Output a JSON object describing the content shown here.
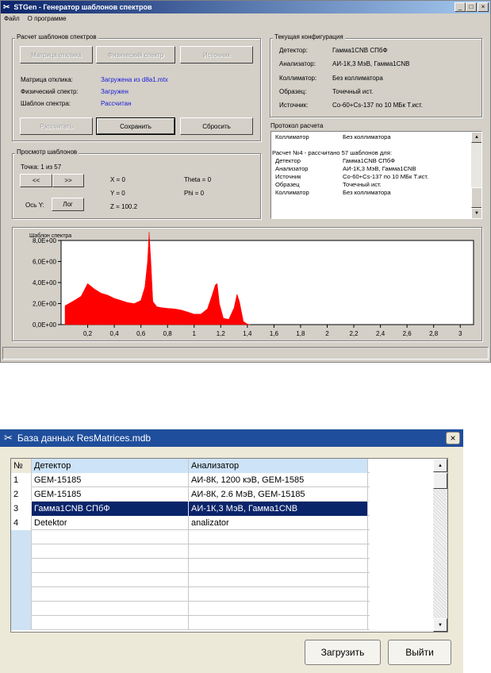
{
  "win1": {
    "title": "STGen - Генератор шаблонов спектров",
    "min": "_",
    "max": "□",
    "close": "×",
    "menu": [
      "Файл",
      "О программе"
    ]
  },
  "calc": {
    "title": "Расчет шаблонов спектров",
    "btn_matrix": "Матрица отклика",
    "btn_phys": "Физический спектр",
    "btn_source": "Источник",
    "rows": [
      {
        "k": "Матрица отклика:",
        "v": "Загружена из d8a1.mtx"
      },
      {
        "k": "Физический спектр:",
        "v": "Загружен"
      },
      {
        "k": "Шаблон спектра:",
        "v": "Рассчитан"
      }
    ],
    "btn_calc": "Рассчитать",
    "btn_save": "Сохранить",
    "btn_reset": "Сбросить"
  },
  "config": {
    "title": "Текущая конфигурация",
    "rows": [
      {
        "k": "Детектор:",
        "v": "Гамма1CNB СПбФ"
      },
      {
        "k": "Анализатор:",
        "v": "АИ-1К,3 МэВ, Гамма1CNB"
      },
      {
        "k": "Коллиматор:",
        "v": "Без коллиматора"
      },
      {
        "k": "Образец:",
        "v": "Точечный ист."
      },
      {
        "k": "Источник:",
        "v": "Co-60+Cs-137 по 10 МБк Т.ист."
      }
    ]
  },
  "protocol": {
    "title": "Протокол расчета",
    "lines": [
      [
        "Коллиматор",
        "Без коллиматора"
      ],
      [
        "",
        ""
      ],
      [
        "Расчет №4 - рассчитано 57 шаблонов для:",
        ""
      ],
      [
        "Детектор",
        "Гамма1CNB СПбФ"
      ],
      [
        "Анализатор",
        "АИ-1К,3 МэВ, Гамма1CNB"
      ],
      [
        "Источник",
        "Co-60+Cs-137 по 10 МБк Т.ист."
      ],
      [
        "Образец",
        "Точечный ист."
      ],
      [
        "Коллиматор",
        "Без коллиматора"
      ]
    ]
  },
  "view": {
    "title": "Просмотр шаблонов",
    "point": "Точка: 1 из 57",
    "prev": "<<",
    "next": ">>",
    "x": "X = 0",
    "y": "Y = 0",
    "z": "Z = 100.2",
    "theta": "Theta = 0",
    "phi": "Phi = 0",
    "axis_label": "Ось Y:",
    "axis_btn": "Лог"
  },
  "chart_data": {
    "type": "area",
    "title": "Шаблон спектра",
    "color": "#ff0000",
    "xlim": [
      0,
      3.1
    ],
    "ylim": [
      0,
      8
    ],
    "xticks": [
      "0,2",
      "0,4",
      "0,6",
      "0,8",
      "1",
      "1,2",
      "1,4",
      "1,6",
      "1,8",
      "2",
      "2,2",
      "2,4",
      "2,6",
      "2,8",
      "3"
    ],
    "yticks": [
      "0,0E+00",
      "2,0E+00",
      "4,0E+00",
      "6,0E+00",
      "8,0E+00"
    ],
    "x": [
      0.03,
      0.1,
      0.15,
      0.2,
      0.25,
      0.3,
      0.35,
      0.4,
      0.45,
      0.5,
      0.55,
      0.6,
      0.63,
      0.65,
      0.662,
      0.675,
      0.69,
      0.72,
      0.76,
      0.8,
      0.85,
      0.9,
      0.95,
      1.0,
      1.05,
      1.1,
      1.13,
      1.16,
      1.173,
      1.19,
      1.22,
      1.26,
      1.3,
      1.322,
      1.34,
      1.37,
      1.4,
      1.42
    ],
    "y": [
      1.8,
      2.3,
      2.7,
      3.9,
      3.4,
      3.0,
      2.8,
      2.5,
      2.3,
      2.1,
      2.0,
      2.3,
      3.6,
      6.0,
      8.8,
      6.0,
      2.2,
      1.7,
      1.6,
      1.55,
      1.5,
      1.4,
      1.2,
      1.0,
      1.0,
      1.5,
      2.6,
      3.8,
      3.9,
      2.0,
      0.6,
      0.5,
      1.6,
      2.9,
      2.2,
      0.3,
      0.05,
      0
    ]
  },
  "win2": {
    "title": "База данных ResMatrices.mdb",
    "close": "×",
    "headers": [
      "№",
      "Детектор",
      "Анализатор"
    ],
    "rows": [
      [
        "1",
        "GEM-15185",
        "АИ-8К, 1200 кэВ, GEM-1585"
      ],
      [
        "2",
        "GEM-15185",
        "АИ-8К, 2.6 МэВ, GEM-15185"
      ],
      [
        "3",
        "Гамма1CNB СПбФ",
        "АИ-1К,3 МэВ, Гамма1CNB"
      ],
      [
        "4",
        "Detektor",
        "analizator"
      ]
    ],
    "selected_row": 3,
    "btn_load": "Загрузить",
    "btn_exit": "Выйти",
    "up": "▲",
    "down": "▼"
  }
}
